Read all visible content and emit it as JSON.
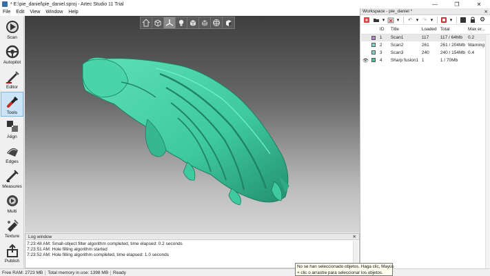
{
  "window": {
    "title": "* E:\\pie_daniel\\pie_daniel.sproj - Artec Studio 11 Trial",
    "minimize": "—",
    "maximize": "❐",
    "close": "✕"
  },
  "menu": [
    "File",
    "Edit",
    "View",
    "Window",
    "Help"
  ],
  "left_tools": [
    {
      "label": "Scan",
      "icon": "scan-icon"
    },
    {
      "label": "Autopilot",
      "icon": "autopilot-icon"
    },
    {
      "label": "Editor",
      "icon": "editor-icon"
    },
    {
      "label": "Tools",
      "icon": "tools-icon",
      "active": true
    },
    {
      "label": "Align",
      "icon": "align-icon"
    },
    {
      "label": "Edges",
      "icon": "edges-icon"
    },
    {
      "label": "Measures",
      "icon": "measures-icon"
    },
    {
      "label": "Multi",
      "icon": "multi-icon"
    },
    {
      "label": "Texture",
      "icon": "texture-icon"
    },
    {
      "label": "Publish",
      "icon": "publish-icon"
    }
  ],
  "viewport_tools": [
    "home-view-icon",
    "perspective-icon",
    "axes-icon",
    "light-icon",
    "solid-icon",
    "wireframe-icon",
    "sphere-icon",
    "texture-view-icon"
  ],
  "colors": {
    "model": "#3ec99e",
    "accent": "#0078d7"
  },
  "log": {
    "title": "Log window",
    "close": "✕",
    "lines": [
      "7:23:48 AM: Small-object filter algorithm completed, time elapsed: 0.2 seconds",
      "7:23:51 AM: Hole filling algorithm started",
      "7:23:52 AM: Hole filling algorithm completed, time elapsed: 1.0 seconds"
    ]
  },
  "workspace": {
    "title": "Workspace - pie_daniel *",
    "close": "✕",
    "columns": [
      "ID",
      "Title",
      "Loaded",
      "Total",
      "Max er..."
    ],
    "rows": [
      {
        "visible": false,
        "color": "#b57edc",
        "id": "1",
        "title": "Scan1",
        "loaded": "117",
        "total": "117 / 64Mb",
        "max_err": "0.2",
        "selected": true
      },
      {
        "visible": false,
        "color": "#7fd6c8",
        "id": "2",
        "title": "Scan2",
        "loaded": "261",
        "total": "261 / 204Mb",
        "max_err": "Warning",
        "selected": false
      },
      {
        "visible": false,
        "color": "#7fd6c8",
        "id": "3",
        "title": "Scan3",
        "loaded": "240",
        "total": "240 / 154Mb",
        "max_err": "0.4",
        "selected": false
      },
      {
        "visible": true,
        "color": "#3ec99e",
        "id": "4",
        "title": "Sharp fusion1",
        "loaded": "1",
        "total": "1 / 70Mb",
        "max_err": "",
        "selected": false
      }
    ]
  },
  "status": {
    "free_ram": "Free RAM: 2723 MB",
    "total_memory": "Total memory in use: 1398 MB",
    "state": "Ready"
  },
  "tooltip": {
    "line1": "No se han seleccionado objetos. Haga clic, Mayús",
    "line2": "+ clic o arrastre para seleccionar los objetos."
  }
}
